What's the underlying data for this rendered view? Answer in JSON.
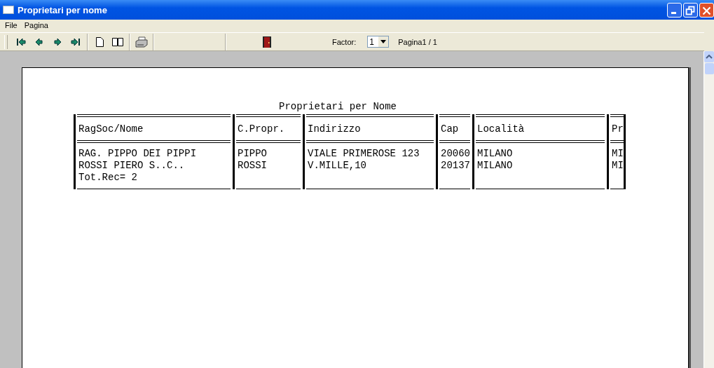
{
  "window": {
    "title": "Proprietari per nome"
  },
  "menu": [
    "File",
    "Pagina"
  ],
  "toolbar": {
    "factor_label": "Factor:",
    "factor_value": "1",
    "page_info": "Pagina1 / 1"
  },
  "report": {
    "title": "Proprietari per Nome",
    "columns": [
      "RagSoc/Nome",
      "C.Propr.",
      "Indirizzo",
      "Cap",
      "Località",
      "Pr"
    ],
    "rows": [
      [
        "RAG. PIPPO DEI PIPPI",
        "PIPPO",
        "VIALE PRIMEROSE 123",
        "20060",
        "MILANO",
        "MI"
      ],
      [
        "ROSSI PIERO S..C..",
        "ROSSI",
        "V.MILLE,10",
        "20137",
        "MILANO",
        "MI"
      ]
    ],
    "total": "Tot.Rec= 2"
  }
}
